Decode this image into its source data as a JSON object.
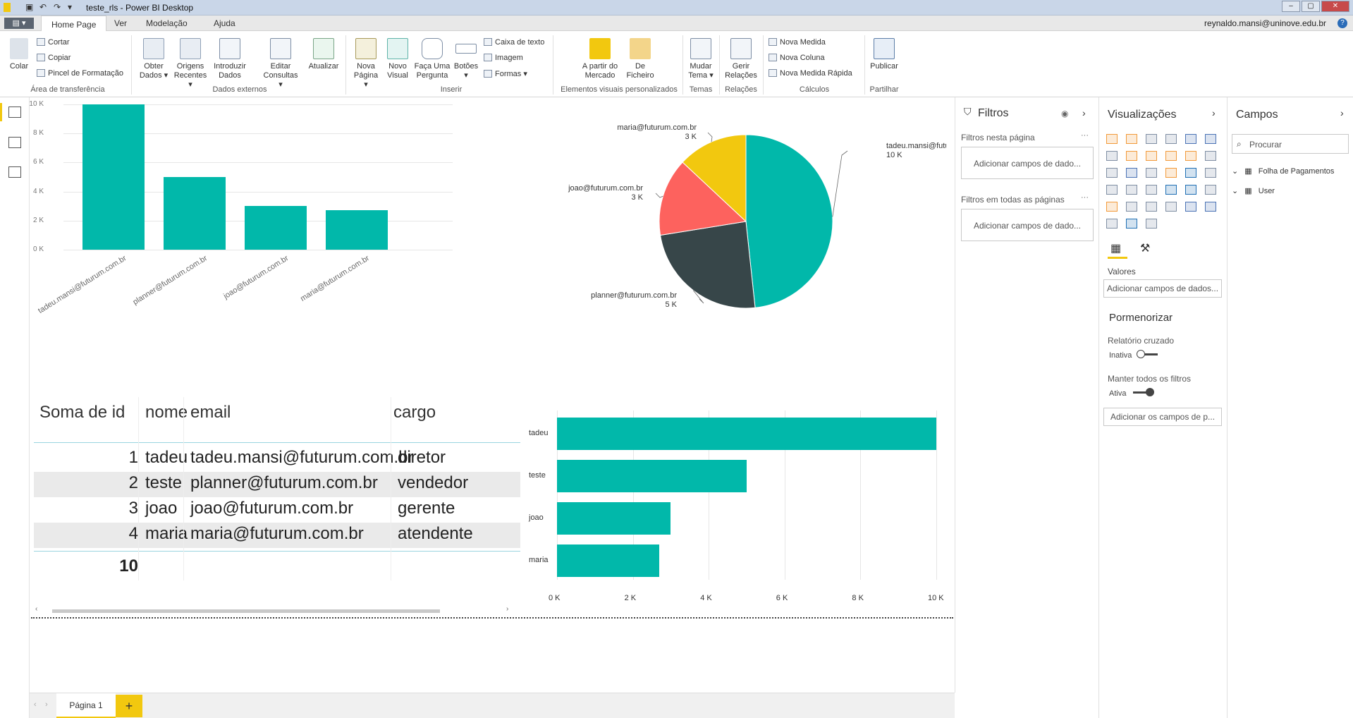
{
  "window": {
    "title": "teste_rls - Power BI Desktop"
  },
  "menu": {
    "tabs": [
      "Home Page",
      "Ver",
      "Modelação",
      "Ajuda"
    ],
    "active": "Home Page",
    "user": "reynaldo.mansi@uninove.edu.br"
  },
  "ribbon": {
    "clipboard": {
      "paste": "Colar",
      "cut": "Cortar",
      "copy": "Copiar",
      "format_painter": "Pincel de Formatação",
      "group": "Área de transferência"
    },
    "data": {
      "get_data": "Obter Dados",
      "recent_sources": "Origens Recentes",
      "enter_data": "Introduzir Dados",
      "edit_queries": "Editar Consultas",
      "refresh": "Atualizar",
      "group": "Dados externos"
    },
    "insert": {
      "new_page": "Nova Página",
      "new_visual": "Novo Visual",
      "ask_question": "Faça Uma Pergunta",
      "buttons": "Botões",
      "textbox": "Caixa de texto",
      "image": "Imagem",
      "shapes": "Formas",
      "group": "Inserir"
    },
    "custom": {
      "marketplace": "A partir do Mercado",
      "from_file": "De Ficheiro",
      "group": "Elementos visuais personalizados"
    },
    "themes": {
      "switch": "Mudar Tema",
      "group": "Temas"
    },
    "relations": {
      "manage": "Gerir Relações",
      "group": "Relações"
    },
    "calc": {
      "new_measure": "Nova Medida",
      "new_column": "Nova Coluna",
      "quick_measure": "Nova Medida Rápida",
      "group": "Cálculos"
    },
    "share": {
      "publish": "Publicar",
      "group": "Partilhar"
    }
  },
  "chart_data": [
    {
      "type": "bar",
      "categories": [
        "tadeu.mansi@futurum.com.br",
        "planner@futurum.com.br",
        "joao@futurum.com.br",
        "maria@futurum.com.br"
      ],
      "values": [
        10000,
        5000,
        3000,
        2700
      ],
      "ylim": [
        0,
        10000
      ],
      "yticks": [
        "0 K",
        "2 K",
        "4 K",
        "6 K",
        "8 K",
        "10 K"
      ],
      "grid": true
    },
    {
      "type": "pie",
      "slices": [
        {
          "label": "tadeu.mansi@futurum.com.br",
          "value_label": "10 K",
          "value": 10000,
          "color": "#01b8aa"
        },
        {
          "label": "planner@futurum.com.br",
          "value_label": "5 K",
          "value": 5000,
          "color": "#374649"
        },
        {
          "label": "joao@futurum.com.br",
          "value_label": "3 K",
          "value": 3000,
          "color": "#fd625e"
        },
        {
          "label": "maria@futurum.com.br",
          "value_label": "3 K",
          "value": 2700,
          "color": "#f2c80f"
        }
      ]
    },
    {
      "type": "bar",
      "orientation": "horizontal",
      "categories": [
        "tadeu",
        "teste",
        "joao",
        "maria"
      ],
      "values": [
        10000,
        5000,
        3000,
        2700
      ],
      "xlim": [
        0,
        10000
      ],
      "xticks": [
        "0 K",
        "2 K",
        "4 K",
        "6 K",
        "8 K",
        "10 K"
      ],
      "grid": true
    }
  ],
  "table": {
    "headers": [
      "Soma de id",
      "nome",
      "email",
      "cargo"
    ],
    "rows": [
      [
        "1",
        "tadeu",
        "tadeu.mansi@futurum.com.br",
        "diretor"
      ],
      [
        "2",
        "teste",
        "planner@futurum.com.br",
        "vendedor"
      ],
      [
        "3",
        "joao",
        "joao@futurum.com.br",
        "gerente"
      ],
      [
        "4",
        "maria",
        "maria@futurum.com.br",
        "atendente"
      ]
    ],
    "total": "10"
  },
  "pages": {
    "current": "Página 1",
    "add": "+"
  },
  "filters": {
    "title": "Filtros",
    "this_page": "Filtros nesta página",
    "all_pages": "Filtros em todas as páginas",
    "add_fields": "Adicionar campos de dado..."
  },
  "visualizations": {
    "title": "Visualizações",
    "values": "Valores",
    "add_fields": "Adicionar campos de dados...",
    "drillthrough": "Pormenorizar",
    "cross_report": "Relatório cruzado",
    "inactive": "Inativa",
    "keep_filters": "Manter todos os filtros",
    "active": "Ativa",
    "add_drill": "Adicionar os campos de p..."
  },
  "fields": {
    "title": "Campos",
    "search": "Procurar",
    "tables": [
      "Folha de Pagamentos",
      "User"
    ]
  },
  "colors": {
    "teal": "#01b8aa",
    "dark": "#374649",
    "red": "#fd625e",
    "yellow": "#f2c80f",
    "accent": "#f2c80f"
  }
}
